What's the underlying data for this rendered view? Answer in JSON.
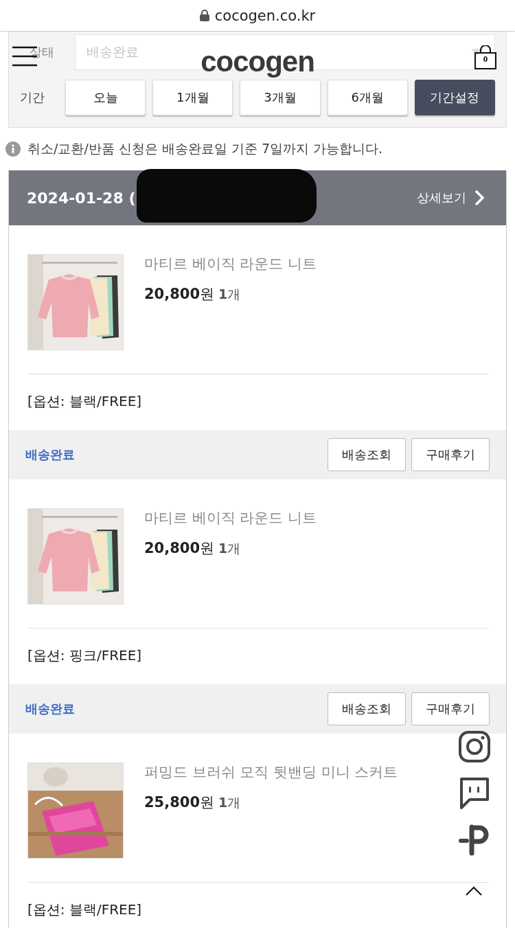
{
  "browser": {
    "url": "cocogen.co.kr"
  },
  "header": {
    "logo": "cocogen",
    "cart_count": "0"
  },
  "filter": {
    "status_label": "상태",
    "status_value": "배송완료",
    "period_label": "기간",
    "periods": [
      {
        "label": "오늘",
        "selected": false
      },
      {
        "label": "1개월",
        "selected": false
      },
      {
        "label": "3개월",
        "selected": false
      },
      {
        "label": "6개월",
        "selected": false
      },
      {
        "label": "기간설정",
        "selected": true
      }
    ]
  },
  "notice": "취소/교환/반품 신청은 배송완료일 기준 7일까지 가능합니다.",
  "order": {
    "date": "2024-01-28 (",
    "detail_link": "상세보기",
    "items": [
      {
        "name": "마티르 베이직 라운드 니트",
        "price": "**20,800**원",
        "quantity": "**1**개",
        "option": "[옵션: 블랙/FREE]",
        "status": "배송완료",
        "buttons": [
          "배송조회",
          "구매후기"
        ]
      },
      {
        "name": "마티르 베이직 라운드 니트",
        "price": "**20,800**원",
        "quantity": "**1**개",
        "option": "[옵션: 핑크/FREE]",
        "status": "배송완료",
        "buttons": [
          "배송조회",
          "구매후기"
        ]
      },
      {
        "name": "퍼밍드 브러쉬 모직 뒷밴딩 미니 스커트",
        "price": "**25,800**원",
        "quantity": "**1**개",
        "option": "[옵션: 블랙/FREE]"
      }
    ]
  }
}
